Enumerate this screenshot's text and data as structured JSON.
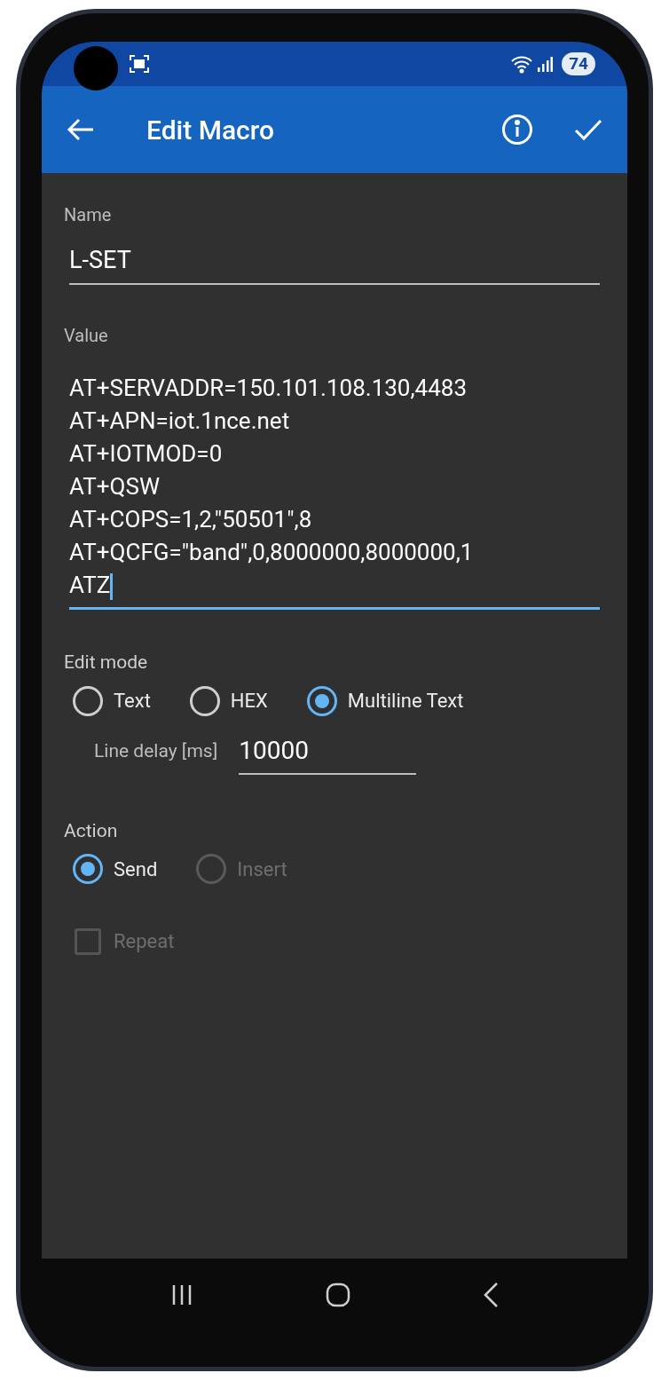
{
  "status_bar": {
    "battery": "74"
  },
  "app_bar": {
    "title": "Edit Macro"
  },
  "name_field": {
    "label": "Name",
    "value": "L-SET"
  },
  "value_field": {
    "label": "Value",
    "focused": true,
    "lines": [
      "AT+SERVADDR=150.101.108.130,4483",
      "AT+APN=iot.1nce.net",
      "AT+IOTMOD=0",
      "AT+QSW",
      "AT+COPS=1,2,\"50501\",8",
      "AT+QCFG=\"band\",0,8000000,8000000,1",
      "ATZ"
    ]
  },
  "edit_mode": {
    "label": "Edit mode",
    "options": [
      {
        "label": "Text",
        "selected": false,
        "disabled": false
      },
      {
        "label": "HEX",
        "selected": false,
        "disabled": false
      },
      {
        "label": "Multiline Text",
        "selected": true,
        "disabled": false
      }
    ]
  },
  "line_delay": {
    "label": "Line delay [ms]",
    "value": "10000"
  },
  "action": {
    "label": "Action",
    "options": [
      {
        "label": "Send",
        "selected": true,
        "disabled": false
      },
      {
        "label": "Insert",
        "selected": false,
        "disabled": true
      }
    ]
  },
  "repeat": {
    "label": "Repeat",
    "checked": false,
    "disabled": true
  }
}
